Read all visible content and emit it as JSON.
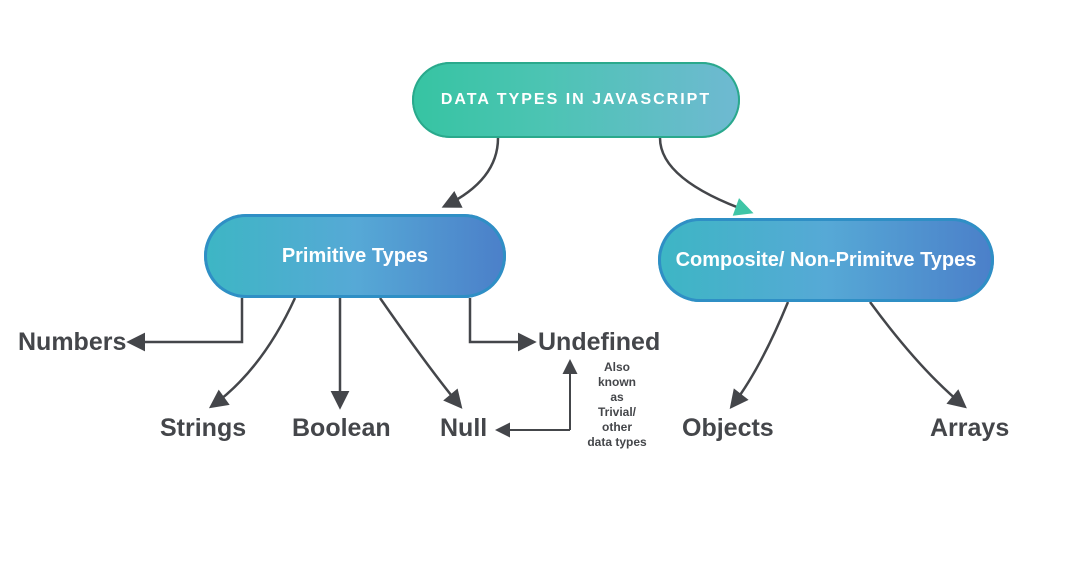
{
  "root": {
    "label": "DATA TYPES IN JAVASCRIPT"
  },
  "branches": {
    "primitive": {
      "label": "Primitive Types"
    },
    "composite": {
      "label": "Composite/ Non-Primitve Types"
    }
  },
  "leaves": {
    "numbers": "Numbers",
    "strings": "Strings",
    "boolean": "Boolean",
    "null": "Null",
    "undefined": "Undefined",
    "objects": "Objects",
    "arrays": "Arrays"
  },
  "note": "Also\nknown\nas\nTrivial/\nother\ndata types",
  "colors": {
    "arrow": "#44464a",
    "arrow_accent": "#3fc5a6"
  }
}
